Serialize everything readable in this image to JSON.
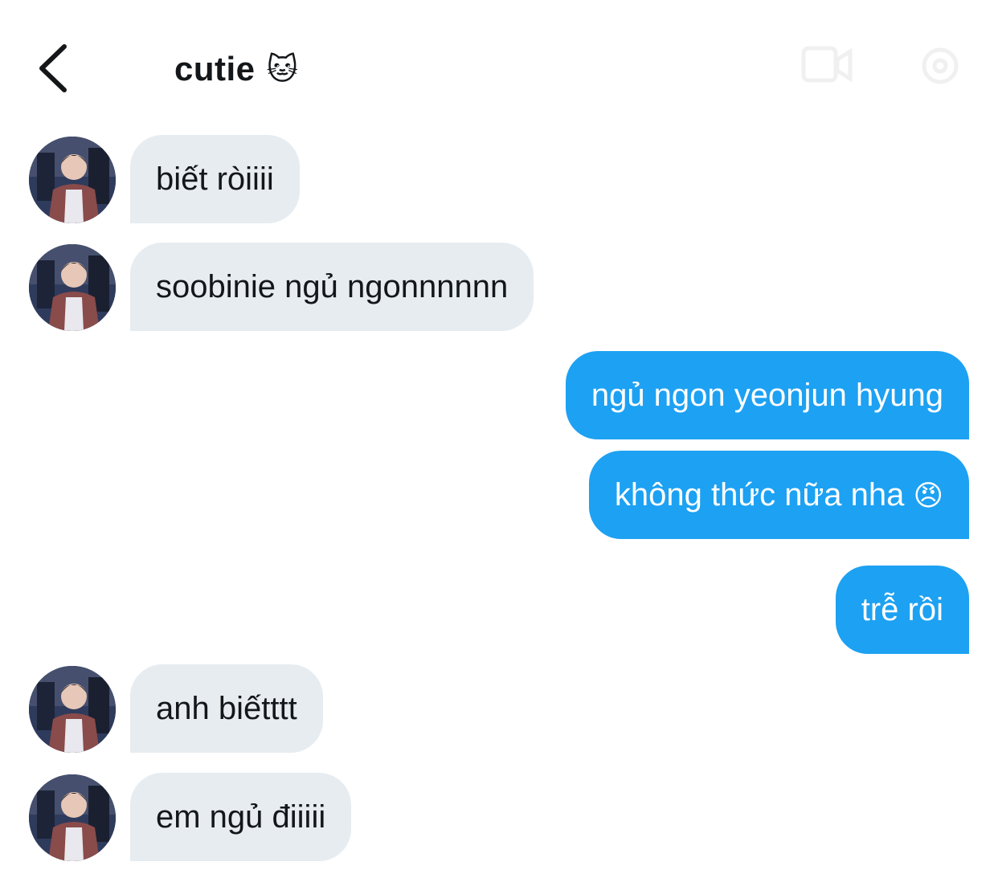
{
  "header": {
    "title": "cutie",
    "title_emoji": "🐱",
    "back_icon": "chevron-left-icon",
    "right_icons": [
      "video-call-icon",
      "settings-icon"
    ]
  },
  "messages": [
    {
      "sender": "other",
      "text": "biết ròiiii"
    },
    {
      "sender": "other",
      "text": "soobinie ngủ ngonnnnnn"
    },
    {
      "sender": "me",
      "text": "ngủ ngon yeonjun hyung"
    },
    {
      "sender": "me",
      "text": "không thức nữa nha",
      "emoji": "😠"
    },
    {
      "sender": "me",
      "text": "trễ rồi"
    },
    {
      "sender": "other",
      "text": "anh biếtttt"
    },
    {
      "sender": "other",
      "text": "em ngủ điiiii"
    }
  ],
  "colors": {
    "incoming_bubble": "#e6ecf0",
    "outgoing_bubble": "#1da1f2",
    "outgoing_text": "#ffffff"
  }
}
